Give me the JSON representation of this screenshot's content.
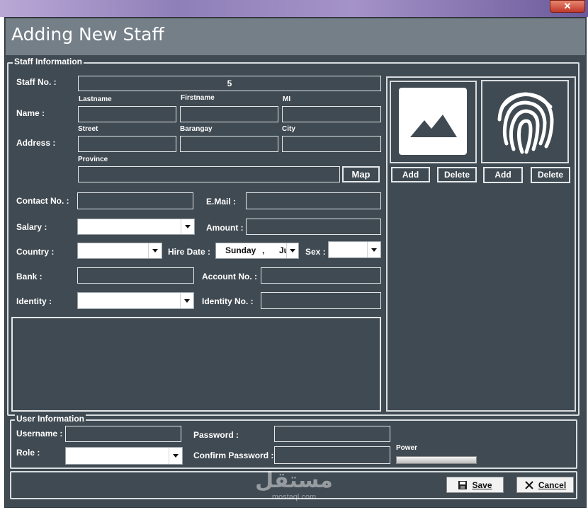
{
  "window": {
    "close_glyph": "✕"
  },
  "header": {
    "title": "Adding New Staff"
  },
  "staff_info": {
    "legend": "Staff Information",
    "staff_no_label": "Staff No. :",
    "staff_no_value": "5",
    "name_label": "Name :",
    "lastname_label": "Lastname",
    "firstname_label": "Firstname",
    "mi_label": "MI",
    "address_label": "Address :",
    "street_label": "Street",
    "barangay_label": "Barangay",
    "city_label": "City",
    "province_label": "Province",
    "map_button": "Map",
    "contact_label": "Contact No. :",
    "email_label": "E.Mail :",
    "salary_label": "Salary :",
    "amount_label": "Amount :",
    "country_label": "Country :",
    "hire_date_label": "Hire Date :",
    "hire_date_day": "Sunday",
    "hire_date_sep": ",",
    "hire_date_month": "Ju",
    "sex_label": "Sex :",
    "bank_label": "Bank :",
    "account_label": "Account No. :",
    "identity_label": "Identity :",
    "identity_no_label": "Identity No. :"
  },
  "media": {
    "photo_icon": "image-placeholder-icon",
    "fingerprint_icon": "fingerprint-icon",
    "photo_add": "Add",
    "photo_delete": "Delete",
    "finger_add": "Add",
    "finger_delete": "Delete"
  },
  "user_info": {
    "legend": "User Information",
    "username_label": "Username :",
    "password_label": "Password :",
    "role_label": "Role :",
    "confirm_label": "Confirm Password :",
    "power_label": "Power",
    "power_level": 0
  },
  "footer": {
    "save_label": "Save",
    "cancel_label": "Cancel"
  },
  "watermark": {
    "text_ar": "مستقل",
    "text_en": "mostaql.com"
  }
}
